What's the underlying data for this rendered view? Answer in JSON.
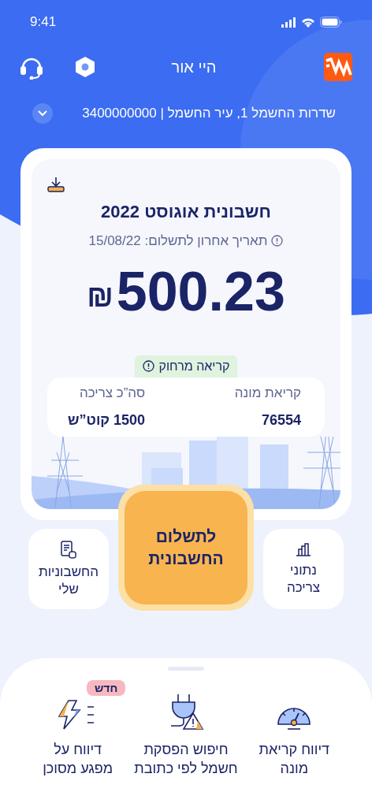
{
  "status_bar": {
    "time": "9:41"
  },
  "header": {
    "greeting": "היי אור"
  },
  "account": {
    "address": "שדרות החשמל 1, עיר החשמל | 3400000000"
  },
  "bill": {
    "title": "חשבונית אוגוסט 2022",
    "due": "תאריך אחרון לתשלום: 15/08/22",
    "amount": "500.23",
    "currency": "₪",
    "badge": "קריאה מרחוק",
    "readings": [
      {
        "label": "קריאת מונה",
        "value": "76554"
      },
      {
        "label": "סה”כ צריכה",
        "value": "1500 קוט”ש"
      }
    ]
  },
  "actions": [
    {
      "kind": "usage",
      "lines": [
        "נתוני",
        "צריכה"
      ]
    },
    {
      "kind": "pay",
      "lines": [
        "לתשלום",
        "החשבונית"
      ]
    },
    {
      "kind": "bills",
      "lines": [
        "החשבוניות",
        "שלי"
      ]
    }
  ],
  "services": [
    {
      "kind": "gauge",
      "lines": [
        "דיווח קריאת",
        "מונה"
      ]
    },
    {
      "kind": "plug",
      "lines": [
        "חיפוש הפסקת",
        "חשמל לפי כתובת"
      ]
    },
    {
      "kind": "bolt",
      "lines": [
        "דיווח על",
        "מפגע מסוכן"
      ],
      "badge": "חדש"
    }
  ]
}
